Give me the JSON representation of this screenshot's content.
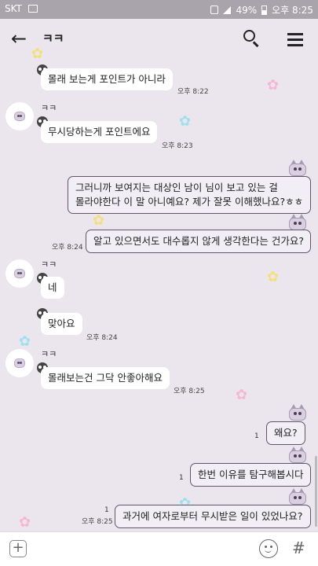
{
  "status_bar": {
    "carrier": "SKT",
    "battery": "49%",
    "time": "오후 8:25"
  },
  "header": {
    "title": "ㅋㅋ"
  },
  "messages": [
    {
      "side": "left",
      "name": "",
      "text": "몰래 보는게 포인트가 아니라",
      "time": "오후 8:22"
    },
    {
      "side": "left",
      "name": "ㅋㅋ",
      "text": "무시당하는게 포인트에요",
      "time": "오후 8:23"
    },
    {
      "side": "right",
      "line1": "그러니까 보여지는 대상인 남이 님이 보고 있는 걸",
      "line2": "몰라야한다 이 말 아니예요? 제가 잘못 이해했나요?ㅎㅎ"
    },
    {
      "side": "right",
      "text": "알고 있으면서도 대수롭지 않게 생각한다는 건가요?",
      "time": "오후 8:24"
    },
    {
      "side": "left",
      "name": "ㅋㅋ",
      "text": "네"
    },
    {
      "side": "left",
      "name": "",
      "text": "맞아요",
      "time": "오후 8:24"
    },
    {
      "side": "left",
      "name": "ㅋㅋ",
      "text": "몰래보는건 그닥 안좋아해요",
      "time": "오후 8:25"
    },
    {
      "side": "right",
      "text": "왜요?",
      "read": "1"
    },
    {
      "side": "right",
      "text": "한번 이유를 탐구해봅시다",
      "read": "1"
    },
    {
      "side": "right",
      "text": "과거에 여자로부터 무시받은 일이 있었나요?",
      "read": "1",
      "time": "오후 8:25"
    }
  ],
  "icons": {
    "back": "arrow-left-icon",
    "search": "search-icon",
    "menu": "hamburger-menu-icon",
    "attach": "plus-icon",
    "emoji": "emoji-icon",
    "hashtag": "hashtag-icon"
  },
  "colors": {
    "background": "#ebe6ee",
    "bubble_mine_border": "#5f566a",
    "statusbar": "#a9a3ab"
  }
}
